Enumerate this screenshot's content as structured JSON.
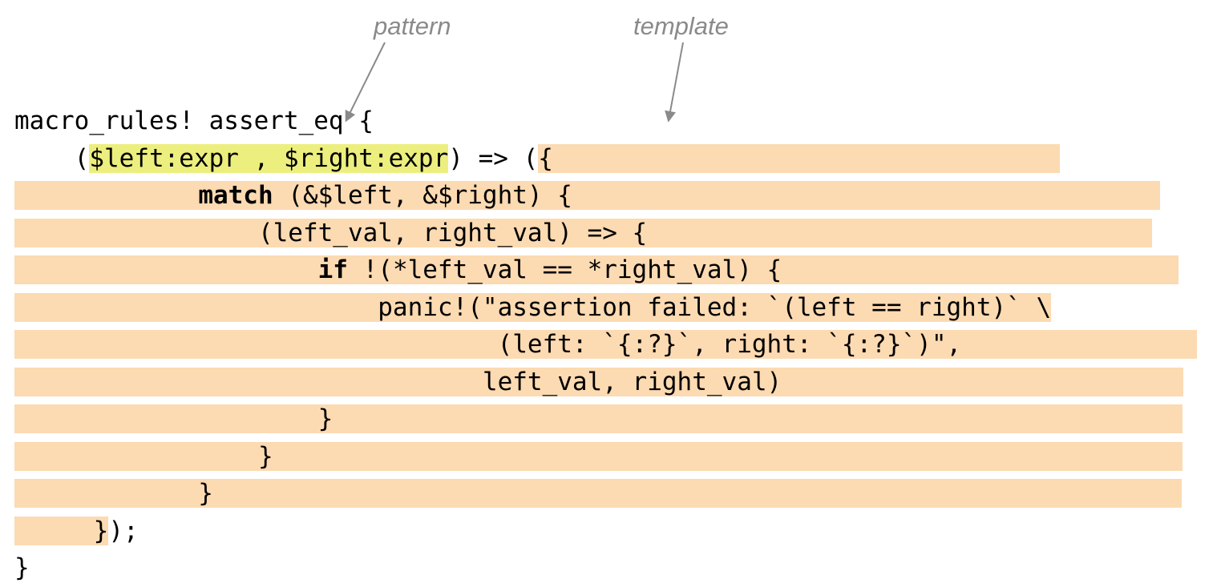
{
  "labels": {
    "pattern": "pattern",
    "template": "template"
  },
  "code": {
    "l1": "macro_rules! assert_eq {",
    "l2a": "    (",
    "l2b": "$left:expr , $right:expr",
    "l2c": ") => (",
    "l2d": "{",
    "l2e": "",
    "l3a": "",
    "l3b": "        ",
    "l3c": "match",
    "l3d": " (&$left, &$right) {",
    "l3e": "",
    "l4a": "",
    "l4b": "            (left_val, right_val) => {",
    "l4c": "",
    "l5a": "",
    "l5b": "                ",
    "l5c": "if",
    "l5d": " !(*left_val == *right_val) {",
    "l5e": "",
    "l6a": "",
    "l6b": "                    panic!(\"assertion failed: `(left == right)` \\",
    "l7a": "",
    "l7b": "                            (left: `{:?}`, right: `{:?}`)\",",
    "l7c": "",
    "l8a": "",
    "l8b": "                           left_val, right_val)",
    "l8c": "",
    "l9a": "",
    "l9b": "                }",
    "l9c": "",
    "l10a": "",
    "l10b": "            }",
    "l10c": "",
    "l11a": "",
    "l11b": "        }",
    "l11c": "",
    "l12a": "   ",
    "l12b": " }",
    "l12c": ");",
    "l13": "}"
  }
}
